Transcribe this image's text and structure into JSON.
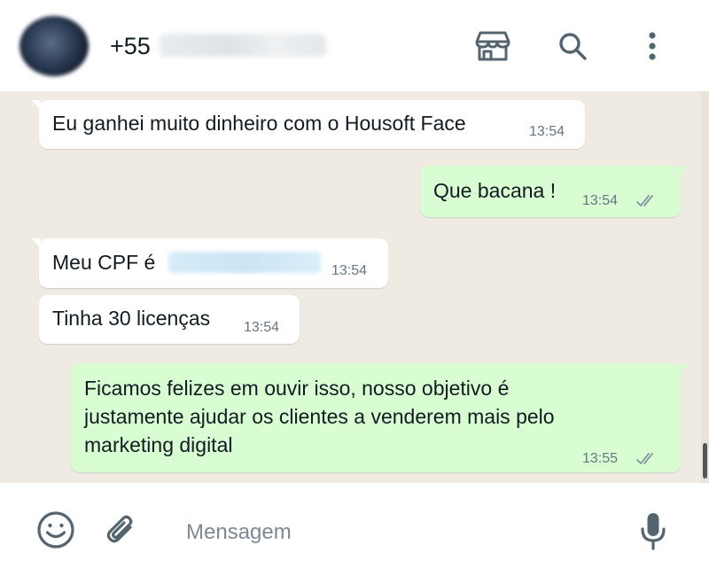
{
  "header": {
    "contact_prefix": "+55",
    "icons": [
      "store-icon",
      "search-icon",
      "more-vertical-icon"
    ]
  },
  "messages": [
    {
      "direction": "in",
      "text": "Eu ganhei muito dinheiro com o Housoft Face",
      "time": "13:54"
    },
    {
      "direction": "out",
      "text": "Que bacana !",
      "time": "13:54",
      "status": "read"
    },
    {
      "direction": "in",
      "text": "Meu CPF é",
      "time": "13:54"
    },
    {
      "direction": "in",
      "text": "Tinha 30 licenças",
      "time": "13:54"
    },
    {
      "direction": "out",
      "lines": [
        "Ficamos felizes em ouvir isso, nosso objetivo é",
        "justamente ajudar os clientes a venderem mais pelo",
        "marketing digital"
      ],
      "time": "13:55",
      "status": "read"
    }
  ],
  "composer": {
    "placeholder": "Mensagem",
    "icons": [
      "emoji-icon",
      "attach-icon",
      "mic-icon"
    ]
  },
  "colors": {
    "chat_background": "#efeae2",
    "incoming_bubble": "#ffffff",
    "outgoing_bubble": "#d9fdd3",
    "icon_color": "#54656f",
    "meta_text": "#667781"
  }
}
